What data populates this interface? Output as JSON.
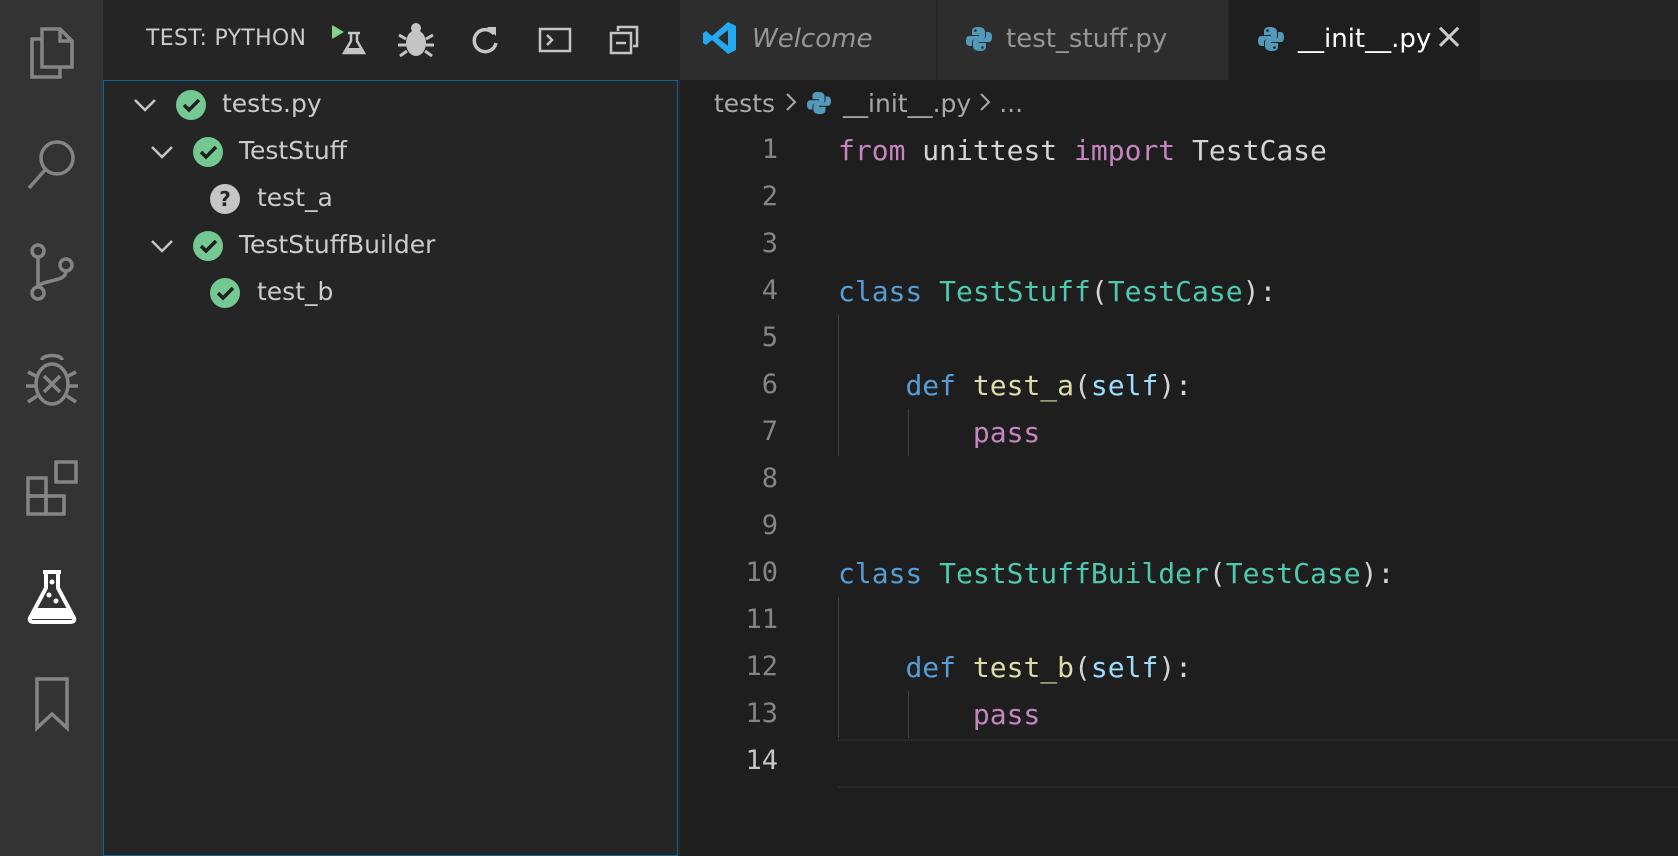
{
  "activity_bar": {
    "items": [
      {
        "icon": "files-icon"
      },
      {
        "icon": "search-icon"
      },
      {
        "icon": "source-control-icon"
      },
      {
        "icon": "debug-icon"
      },
      {
        "icon": "extensions-icon"
      },
      {
        "icon": "testing-flask-icon",
        "active": true
      },
      {
        "icon": "bookmark-icon"
      }
    ]
  },
  "sidebar": {
    "title": "TEST: PYTHON",
    "tools": [
      "run-tests-icon",
      "debug-tests-icon",
      "refresh-icon",
      "output-icon",
      "collapse-all-icon"
    ],
    "tree": [
      {
        "label": "tests.py",
        "status": "passed",
        "expanded": true,
        "depth": 0
      },
      {
        "label": "TestStuff",
        "status": "passed",
        "expanded": true,
        "depth": 1
      },
      {
        "label": "test_a",
        "status": "unknown",
        "depth": 2
      },
      {
        "label": "TestStuffBuilder",
        "status": "passed",
        "expanded": true,
        "depth": 1
      },
      {
        "label": "test_b",
        "status": "passed",
        "depth": 2
      }
    ]
  },
  "tabs": [
    {
      "label": "Welcome",
      "icon": "vscode-icon",
      "active": false
    },
    {
      "label": "test_stuff.py",
      "icon": "python-icon",
      "active": false
    },
    {
      "label": "__init__.py",
      "icon": "python-icon",
      "active": true,
      "close": "×"
    }
  ],
  "breadcrumb": {
    "folder": "tests",
    "file": "__init__.py",
    "more": "..."
  },
  "code": {
    "line_numbers": [
      "1",
      "2",
      "3",
      "4",
      "5",
      "6",
      "7",
      "8",
      "9",
      "10",
      "11",
      "12",
      "13",
      "14"
    ],
    "tokens": {
      "l1": [
        "from",
        " unittest ",
        "import",
        " TestCase"
      ],
      "l4": [
        "class",
        " ",
        "TestStuff",
        "(",
        "TestCase",
        "):"
      ],
      "l6": [
        "    ",
        "def",
        " ",
        "test_a",
        "(",
        "self",
        "):"
      ],
      "l7": [
        "        ",
        "pass"
      ],
      "l10": [
        "class",
        " ",
        "TestStuffBuilder",
        "(",
        "TestCase",
        "):"
      ],
      "l12": [
        "    ",
        "def",
        " ",
        "test_b",
        "(",
        "self",
        "):"
      ],
      "l13": [
        "        ",
        "pass"
      ]
    },
    "current_line": 14
  },
  "colors": {
    "pass_green": "#73c991",
    "unknown_gray": "#c5c5c5",
    "python_blue": "#519aba",
    "vscode_blue": "#23a9f2",
    "run_green": "#89d185"
  }
}
